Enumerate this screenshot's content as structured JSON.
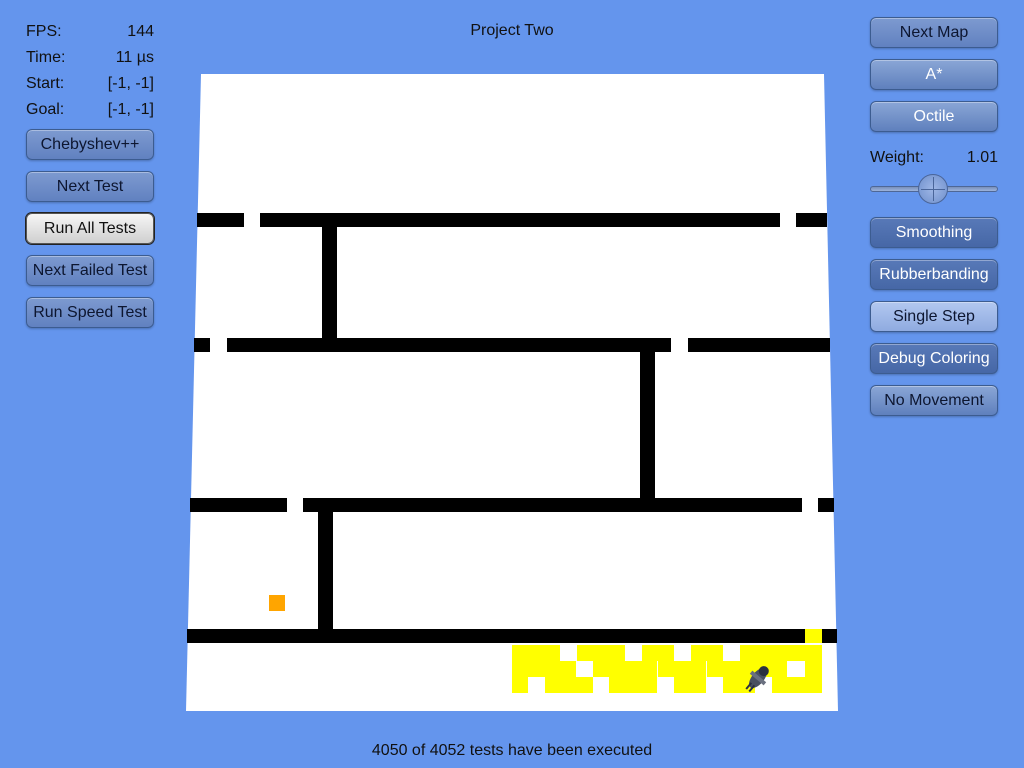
{
  "title": "Project Two",
  "stats": {
    "fps_label": "FPS:",
    "fps_value": "144",
    "time_label": "Time:",
    "time_value": "11 µs",
    "start_label": "Start:",
    "start_value": "[-1, -1]",
    "goal_label": "Goal:",
    "goal_value": "[-1, -1]"
  },
  "left_buttons": {
    "heuristic": "Chebyshev++",
    "next_test": "Next Test",
    "run_all_tests": "Run All Tests",
    "next_failed_test": "Next Failed Test",
    "run_speed_test": "Run Speed Test"
  },
  "right_buttons": {
    "next_map": "Next Map",
    "algorithm": "A*",
    "heuristic_mode": "Octile",
    "smoothing": "Smoothing",
    "rubberbanding": "Rubberbanding",
    "single_step": "Single Step",
    "debug_coloring": "Debug Coloring",
    "no_movement": "No Movement"
  },
  "weight": {
    "label": "Weight:",
    "value": "1.01",
    "slider_fraction": 0.5
  },
  "footer": "4050 of 4052 tests have been executed",
  "colors": {
    "background": "#6495ed",
    "floor": "#ffffff",
    "wall": "#000000",
    "visited": "#ffff00",
    "marker": "#ffa500"
  },
  "icons": {
    "agent": "agent-icon",
    "marker": "marker-square"
  }
}
